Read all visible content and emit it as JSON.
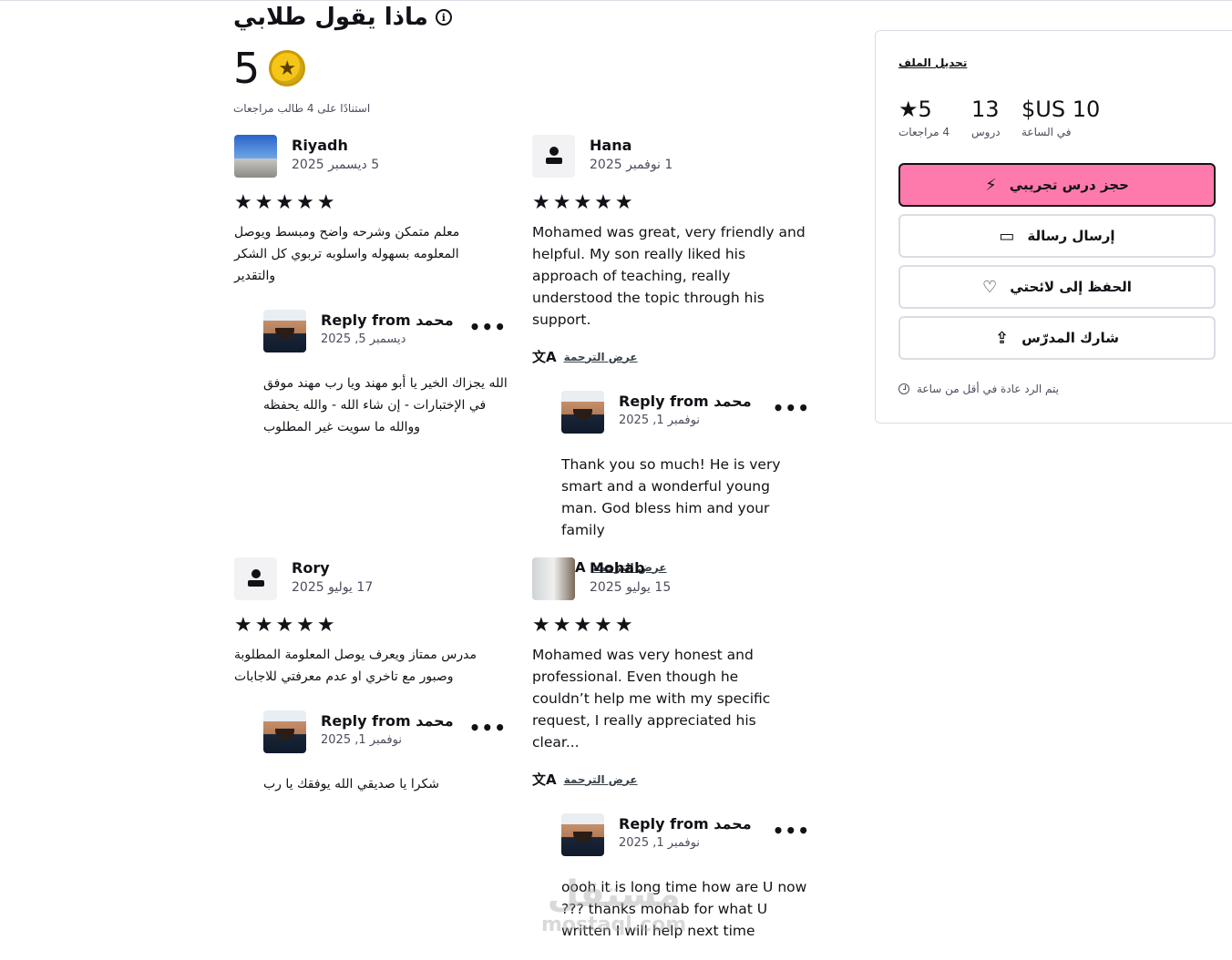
{
  "header": {
    "title": "ماذا يقول طلابي",
    "info_icon": "info-icon",
    "rating": "5",
    "medal_icon": "star-medal-icon",
    "based_on": "استنادًا على 4 طالب مراجعات"
  },
  "reviews": [
    {
      "name": "Riyadh",
      "date": "5 ديسمبر 2025",
      "stars": "★★★★★",
      "text": "معلم متمكن وشرحه واضح ومبسط ويوصل المعلومه بسهوله واسلوبه تربوي كل الشكر والتقدير",
      "reply": {
        "title": "Reply from محمد",
        "date": "ديسمبر 5, 2025",
        "text": "الله يجزاك الخير يا أبو مهند ويا رب مهند موفق في الإختبارات - إن شاء الله - والله يحفظه ووالله ما سويت غير المطلوب"
      }
    },
    {
      "name": "Hana",
      "date": "1 نوفمبر 2025",
      "stars": "★★★★★",
      "text": "Mohamed was great, very friendly and helpful. My son really liked his approach of teaching, really understood the topic through his support.",
      "translate": "عرض الترجمة",
      "reply": {
        "title": "Reply from محمد",
        "date": "نوفمبر 1, 2025",
        "text": "Thank you so much! He is very smart and a wonderful young man. God bless him and your family",
        "translate": "عرض الترجمة"
      }
    },
    {
      "name": "Rory",
      "date": "17 يوليو 2025",
      "stars": "★★★★★",
      "text": "مدرس ممتاز ويعرف يوصل المعلومة المطلوبة وصبور مع تاخري او عدم معرفتي للاجابات",
      "reply": {
        "title": "Reply from محمد",
        "date": "نوفمبر 1, 2025",
        "text": "شكرا يا صديقي الله يوفقك يا رب"
      }
    },
    {
      "name": "Mohab",
      "date": "15 يوليو 2025",
      "stars": "★★★★★",
      "text": "Mohamed was very honest and professional. Even though he couldn’t help me with my specific request, I really appreciated his clear...",
      "translate": "عرض الترجمة",
      "reply": {
        "title": "Reply from محمد",
        "date": "نوفمبر 1, 2025",
        "text": "oooh it is long time how are U now ??? thanks mohab for what U written I will help next time"
      }
    }
  ],
  "more_label": "•••",
  "translate_icon": "translate-icon",
  "sidebar": {
    "edit_profile": "تحديل الملف",
    "rating_value": "★5",
    "rating_label": "4 مراجعات",
    "lessons_value": "13",
    "lessons_label": "دروس",
    "price_value": "$US 10",
    "price_label": "في الساعة",
    "book_trial": "حجز درس تجريبي",
    "book_icon": "lightning-icon",
    "send_message": "إرسال رسالة",
    "message_icon": "chat-icon",
    "save_to_list": "الحفظ إلى لائحتي",
    "heart_icon": "heart-icon",
    "share_tutor": "شارك المدرّس",
    "share_icon": "share-icon",
    "response_note": "يتم الرد عادة في أقل من ساعة",
    "accent_color": "#ff7aac"
  },
  "watermark": {
    "line1": "مستقل",
    "line2": "mostaql.com"
  }
}
